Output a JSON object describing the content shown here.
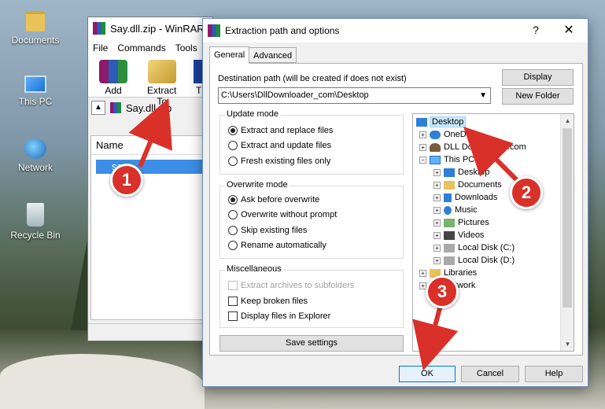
{
  "desktop": {
    "icons": [
      {
        "label": "Documents",
        "icon": "folder-icon"
      },
      {
        "label": "This PC",
        "icon": "computer-icon"
      },
      {
        "label": "Network",
        "icon": "network-icon"
      },
      {
        "label": "Recycle Bin",
        "icon": "recycle-bin-icon"
      }
    ]
  },
  "winrar": {
    "title": "Say.dll.zip - WinRAR",
    "menu": [
      "File",
      "Commands",
      "Tools"
    ],
    "toolbar": {
      "add_label": "Add",
      "extract_label": "Extract To",
      "third_label": "T"
    },
    "path": "Say.dll.zip",
    "list_header": "Name",
    "selected_row": "say"
  },
  "dialog": {
    "title": "Extraction path and options",
    "help": "?",
    "close": "✕",
    "tabs": [
      "General",
      "Advanced"
    ],
    "dest_label": "Destination path (will be created if does not exist)",
    "dest_value": "C:\\Users\\DllDownloader_com\\Desktop",
    "display_button": "Display",
    "new_folder_button": "New Folder",
    "update_mode": {
      "title": "Update mode",
      "options": [
        "Extract and replace files",
        "Extract and update files",
        "Fresh existing files only"
      ],
      "selected": 0
    },
    "overwrite_mode": {
      "title": "Overwrite mode",
      "options": [
        "Ask before overwrite",
        "Overwrite without prompt",
        "Skip existing files",
        "Rename automatically"
      ],
      "selected": 0
    },
    "misc": {
      "title": "Miscellaneous",
      "options": [
        "Extract archives to subfolders",
        "Keep broken files",
        "Display files in Explorer"
      ]
    },
    "save_settings": "Save settings",
    "tree": {
      "desktop": "Desktop",
      "onedrive": "OneDrive",
      "user": "DLL Downloader.com",
      "this_pc": "This PC",
      "pc_children": [
        "Desktop",
        "Documents",
        "Downloads",
        "Music",
        "Pictures",
        "Videos",
        "Local Disk (C:)",
        "Local Disk (D:)"
      ],
      "libraries": "Libraries",
      "network": "Network"
    },
    "ok": "OK",
    "cancel": "Cancel",
    "help_button": "Help"
  },
  "annotations": [
    "1",
    "2",
    "3"
  ],
  "colors": {
    "badge": "#d9302a",
    "arrow": "#d9302a",
    "selection": "#cce8ff"
  }
}
